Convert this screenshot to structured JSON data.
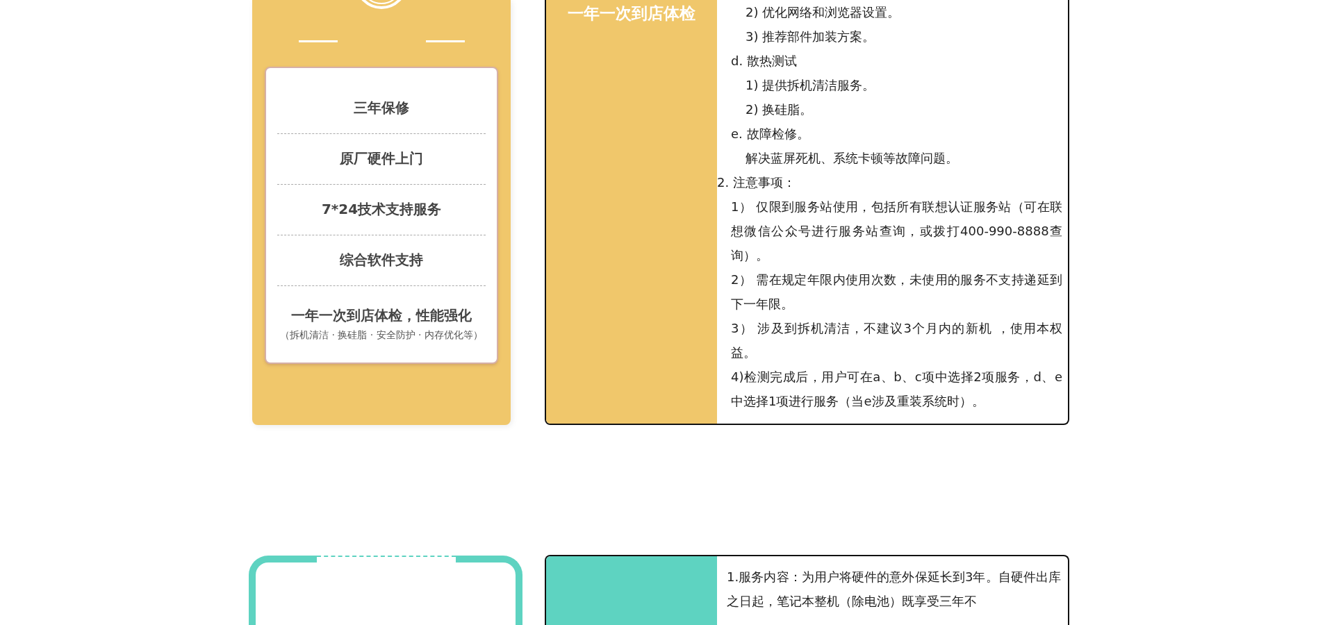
{
  "sections": [
    {
      "kind": "summary",
      "color": "#f0c76b",
      "features": [
        {
          "title": "三年保修"
        },
        {
          "title": "原厂硬件上门"
        },
        {
          "title": "7*24技术支持服务"
        },
        {
          "title": "综合软件支持"
        },
        {
          "title": "一年一次到店体检，性能强化",
          "note": "（拆机清洁 · 换硅脂 · 安全防护 · 内存优化等）"
        }
      ],
      "detail": {
        "heading": "一年一次到店体检",
        "lines": [
          {
            "kind": "step",
            "text": "2) 优化网络和浏览器设置。"
          },
          {
            "kind": "step",
            "text": "3) 推荐部件加装方案。"
          },
          {
            "kind": "letter",
            "text": "d. 散热测试"
          },
          {
            "kind": "step",
            "text": "1) 提供拆机清洁服务。"
          },
          {
            "kind": "step",
            "text": "2) 换硅脂。"
          },
          {
            "kind": "letter",
            "text": "e. 故障检修。"
          },
          {
            "kind": "step",
            "text": "解决蓝屏死机、系统卡顿等故障问题。"
          },
          {
            "kind": "section",
            "text": "2. 注意事项："
          },
          {
            "kind": "note",
            "text": "1） 仅限到服务站使用，包括所有联想认证服务站（可在联想微信公众号进行服务站查询，或拨打400-990-8888查询）。"
          },
          {
            "kind": "note",
            "text": "2） 需在规定年限内使用次数，未使用的服务不支持递延到下一年限。"
          },
          {
            "kind": "note",
            "text": "3） 涉及到拆机清洁，不建议3个月内的新机 ，使用本权益。"
          },
          {
            "kind": "note",
            "text": "4)检测完成后，用户可在a、b、c项中选择2项服务，d、e中选择1项进行服务（当e涉及重装系统时）。"
          }
        ]
      }
    },
    {
      "kind": "frame",
      "color": "#5ed3c1",
      "detail": {
        "lines": [
          {
            "kind": "para",
            "text": "1.服务内容：为用户将硬件的意外保延长到3年。自硬件出库之日起，笔记本整机（除电池）既享受三年不"
          }
        ]
      }
    }
  ]
}
